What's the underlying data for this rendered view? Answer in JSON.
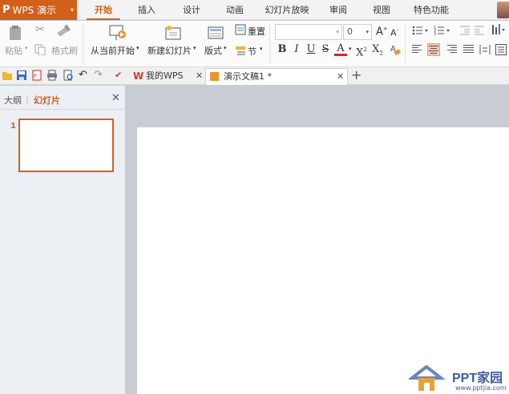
{
  "app": {
    "logo": "P",
    "name": "WPS 演示",
    "caret": "▾"
  },
  "menu": [
    {
      "label": "开始",
      "active": true
    },
    {
      "label": "插入"
    },
    {
      "label": "设计"
    },
    {
      "label": "动画"
    },
    {
      "label": "幻灯片放映"
    },
    {
      "label": "审阅"
    },
    {
      "label": "视图"
    },
    {
      "label": "特色功能"
    }
  ],
  "ribbon": {
    "paste": "粘贴",
    "format_painter": "格式刷",
    "from_current": "从当前开始",
    "new_slide": "新建幻灯片",
    "layout": "版式",
    "reset": "重置",
    "section": "节",
    "font_size": "0",
    "grow_font": "A",
    "shrink_font": "A",
    "bold": "B",
    "italic": "I",
    "underline": "U",
    "strike": "S",
    "font_color": "A",
    "superscript": "X",
    "subscript": "X",
    "sup_mark": "2",
    "sub_mark": "2"
  },
  "tabs": {
    "my_wps": "我的WPS",
    "doc": "演示文稿1 *",
    "add": "+"
  },
  "panel": {
    "outline_tab": "大纲",
    "divider": "|",
    "slides_tab": "幻灯片",
    "slide_number": "1"
  },
  "watermark": {
    "text": "PPT家园",
    "url": "www.pptjia.com"
  },
  "colors": {
    "accent": "#d2601b",
    "wps_red": "#d83a2a"
  }
}
